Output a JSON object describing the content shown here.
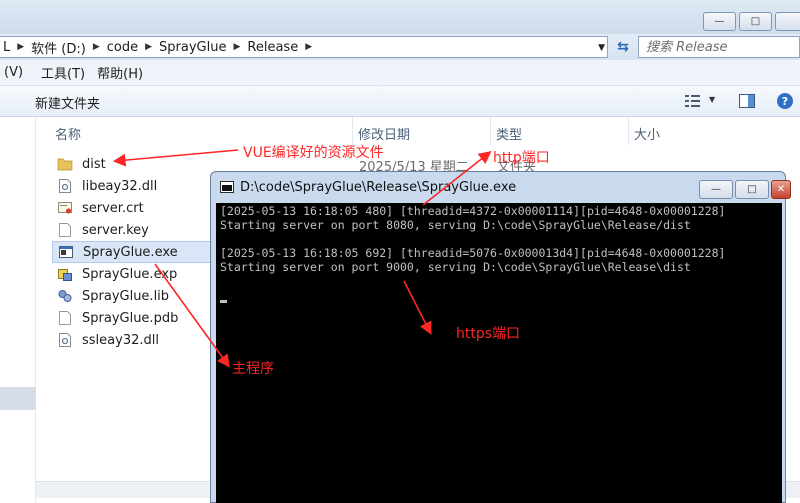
{
  "explorer": {
    "address_crumbs": [
      "软件 (D:)",
      "code",
      "SprayGlue",
      "Release"
    ],
    "search_placeholder": "搜索 Release",
    "menu": [
      "(V)",
      "工具(T)",
      "帮助(H)"
    ],
    "toolbar_new_folder": "新建文件夹",
    "columns": {
      "name": "名称",
      "modified": "修改日期",
      "type": "类型",
      "size": "大小"
    },
    "files": [
      {
        "name": "dist",
        "icon": "folder-icon",
        "selected": false
      },
      {
        "name": "libeay32.dll",
        "icon": "dll-file-icon",
        "selected": false
      },
      {
        "name": "server.crt",
        "icon": "certificate-file-icon",
        "selected": false
      },
      {
        "name": "server.key",
        "icon": "blank-file-icon",
        "selected": false
      },
      {
        "name": "SprayGlue.exe",
        "icon": "exe-file-icon",
        "selected": true
      },
      {
        "name": "SprayGlue.exp",
        "icon": "exp-file-icon",
        "selected": false
      },
      {
        "name": "SprayGlue.lib",
        "icon": "lib-file-icon",
        "selected": false
      },
      {
        "name": "SprayGlue.pdb",
        "icon": "pdb-file-icon",
        "selected": false
      },
      {
        "name": "ssleay32.dll",
        "icon": "dll-file-icon",
        "selected": false
      }
    ],
    "dist_modified": "2025/5/13 星期二",
    "dist_type": "文件夹"
  },
  "console": {
    "title": "D:\\code\\SprayGlue\\Release\\SprayGlue.exe",
    "lines": [
      "[2025-05-13 16:18:05 480] [threadid=4372-0x00001114][pid=4648-0x00001228]",
      "Starting server on port 8080, serving D:\\code\\SprayGlue\\Release/dist",
      "",
      "[2025-05-13 16:18:05 692] [threadid=5076-0x000013d4][pid=4648-0x00001228]",
      "Starting server on port 9000, serving D:\\code\\SprayGlue\\Release\\dist"
    ]
  },
  "annotations": {
    "vue": "VUE编译好的资源文件",
    "http": "http端口",
    "https": "https端口",
    "main": "主程序",
    "color": "#ff2626"
  }
}
